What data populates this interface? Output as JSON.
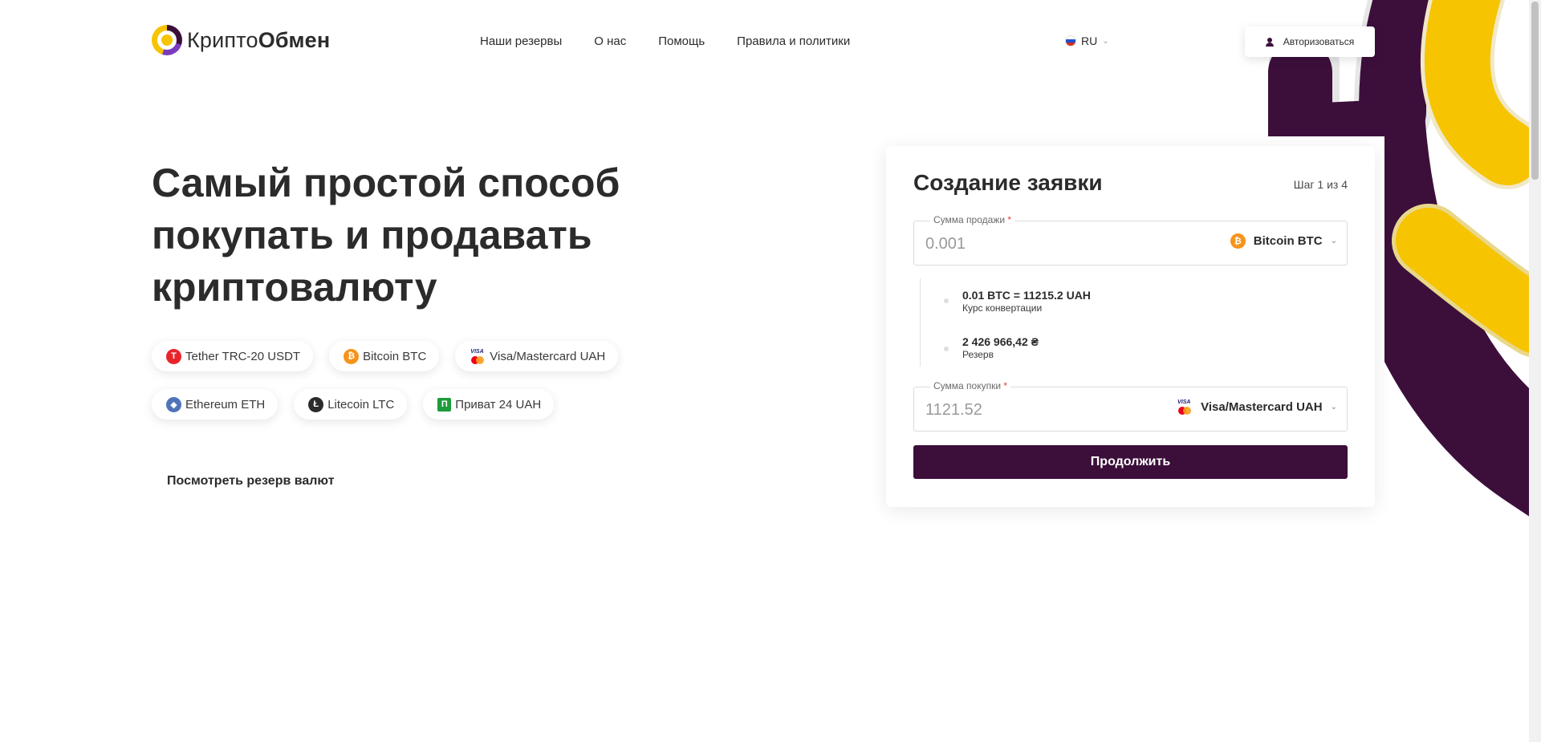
{
  "header": {
    "logo": {
      "light": "Крипто",
      "bold": "Обмен"
    },
    "nav": [
      "Наши резервы",
      "О нас",
      "Помощь",
      "Правила и политики"
    ],
    "lang": "RU",
    "login": "Авторизоваться"
  },
  "hero": {
    "title": "Самый простой способ покупать и продавать криптовалюту",
    "chips": [
      {
        "label": "Tether TRC-20 USDT",
        "icon": "tether-icon"
      },
      {
        "label": "Bitcoin BTC",
        "icon": "bitcoin-icon"
      },
      {
        "label": "Visa/Mastercard UAH",
        "icon": "visa-mastercard-icon"
      },
      {
        "label": "Ethereum ETH",
        "icon": "ethereum-icon"
      },
      {
        "label": "Litecoin LTC",
        "icon": "litecoin-icon"
      },
      {
        "label": "Приват 24 UAH",
        "icon": "privat24-icon"
      }
    ],
    "reserve_link": "Посмотреть резерв валют"
  },
  "order": {
    "title": "Создание заявки",
    "step": "Шаг 1 из 4",
    "sell": {
      "label": "Сумма продажи",
      "required_mark": "*",
      "placeholder": "0.001",
      "currency": "Bitcoin BTC"
    },
    "rate": {
      "value": "0.01 BTC = 11215.2 UAH",
      "label": "Курс конвертации"
    },
    "reserve": {
      "value": "2 426 966,42 ₴",
      "label": "Резерв"
    },
    "buy": {
      "label": "Сумма покупки",
      "required_mark": "*",
      "placeholder": "1121.52",
      "currency": "Visa/Mastercard UAH"
    },
    "continue": "Продолжить"
  },
  "colors": {
    "brand": "#3c0f3b",
    "accent": "#f6c400",
    "text": "#2b2b2b"
  }
}
